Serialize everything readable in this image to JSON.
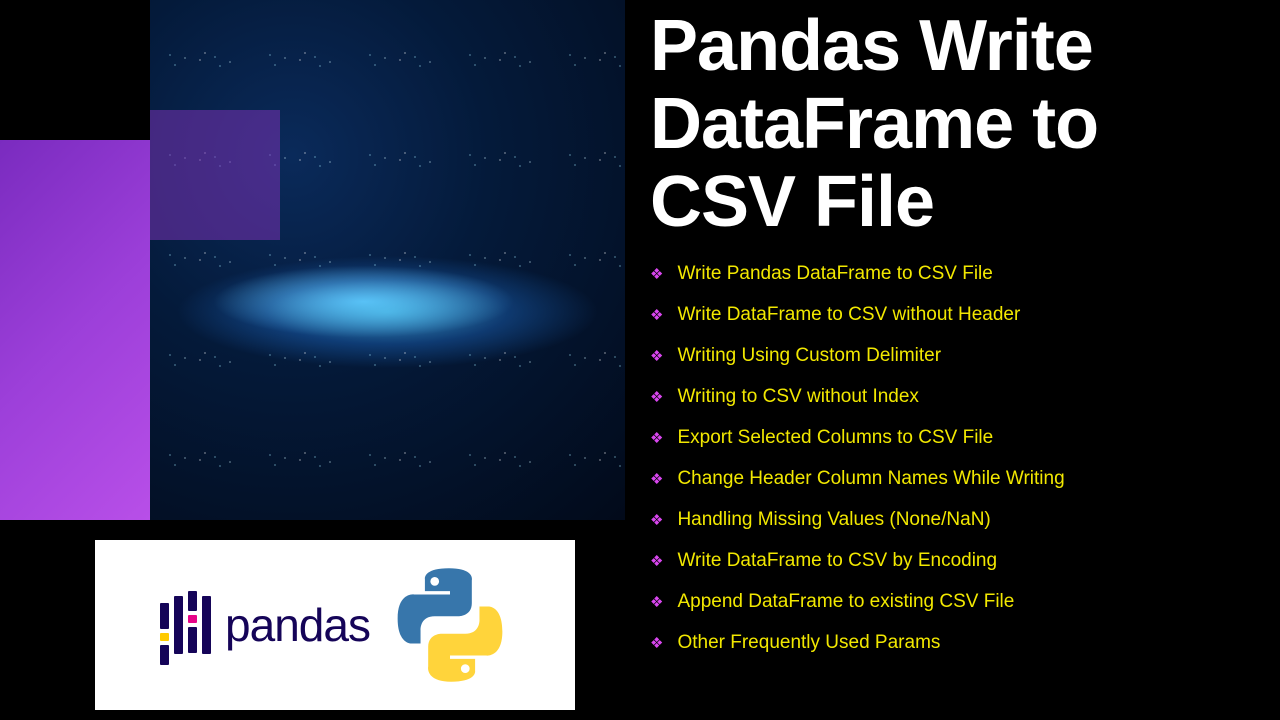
{
  "title": "Pandas Write DataFrame to CSV File",
  "logo_text": "pandas",
  "bullets": [
    "Write Pandas DataFrame to CSV File",
    "Write DataFrame to CSV without Header",
    "Writing Using Custom Delimiter",
    "Writing to CSV without Index",
    "Export Selected Columns to CSV File",
    "Change Header Column Names While Writing",
    "Handling Missing Values (None/NaN)",
    "Write DataFrame to CSV by Encoding",
    "Append DataFrame to existing CSV File",
    "Other Frequently Used Params"
  ],
  "colors": {
    "title": "#ffffff",
    "bullet_text": "#f2e800",
    "bullet_marker": "#d946ef",
    "background": "#000000"
  }
}
